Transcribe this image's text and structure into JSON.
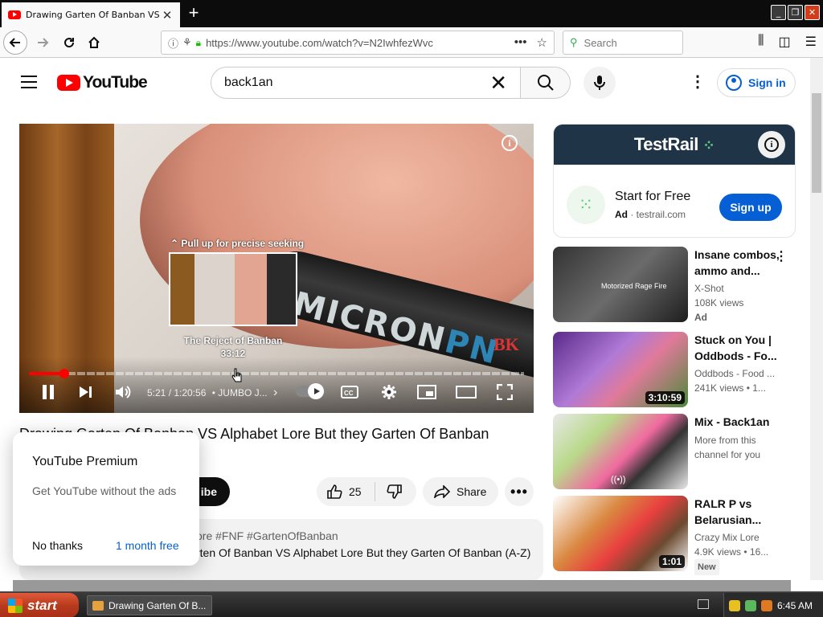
{
  "browser": {
    "tab_title": "Drawing Garten Of Banban VS Alphabet Lore But they Garten Of Banban",
    "tab_close": "✕",
    "new_tab": "+",
    "window_buttons": [
      "_",
      "❐",
      "✕"
    ],
    "url": "https://www.youtube.com/watch?v=N2IwhfezWvc",
    "url_more": "•••",
    "search_placeholder": "Search"
  },
  "youtube": {
    "logo_text": "YouTube",
    "search_query": "back1an",
    "clear_label": "✕",
    "signin_label": "Sign in",
    "kebab": "⋮"
  },
  "player": {
    "seek_hint": "⌃ Pull up for precise seeking",
    "preview_title": "The Reject of Banban",
    "preview_time": "33:12",
    "pen_text_a": "MICRON",
    "pen_text_b": "PN",
    "watermark": "BK",
    "info": "i",
    "played_fraction": 0.071,
    "time": "5:21 / 1:20:56",
    "chapter": "• JUMBO J...",
    "chapter_chevron": "›"
  },
  "video": {
    "title": "Drawing Garten Of Banban VS Alphabet Lore But they Garten Of Banban",
    "subscribe_label": "ibe",
    "likes": "25",
    "share_label": "Share",
    "more_label": "•••",
    "tags": "ore #FNF #GartenOfBanban",
    "description": "rten Of Banban VS Alphabet Lore But they Garten Of Banban (A-Z)"
  },
  "premium_popup": {
    "title": "YouTube Premium",
    "body": "Get YouTube without the ads",
    "decline": "No thanks",
    "accept": "1 month free"
  },
  "ad": {
    "brand": "TestRail",
    "brand_mark": "⁘",
    "info": "i",
    "headline": "Start for Free",
    "badge": "Ad",
    "domain": "testrail.com",
    "cta": "Sign up"
  },
  "recommendations": [
    {
      "title": "Insane combos, ammo and...",
      "channel": "X-Shot",
      "views": "108K views",
      "badge": "Ad",
      "thumb_label": "Motorized Rage Fire",
      "duration": ""
    },
    {
      "title": "Stuck on You | Oddbods - Fo...",
      "channel": "Oddbods - Food ...",
      "views": "241K views  •  1...",
      "duration": "3:10:59"
    },
    {
      "title": "Mix - Back1an",
      "channel": "More from this",
      "views": "channel for you",
      "live_icon": "((•))",
      "duration": ""
    },
    {
      "title": "RALR P vs Belarusian...",
      "channel": "Crazy Mix Lore",
      "views": "4.9K views  •  16...",
      "badge_new": "New",
      "duration": "1:01"
    }
  ],
  "taskbar": {
    "start_label": "start",
    "task_item": "Drawing Garten Of B...",
    "clock": "6:45 AM"
  }
}
